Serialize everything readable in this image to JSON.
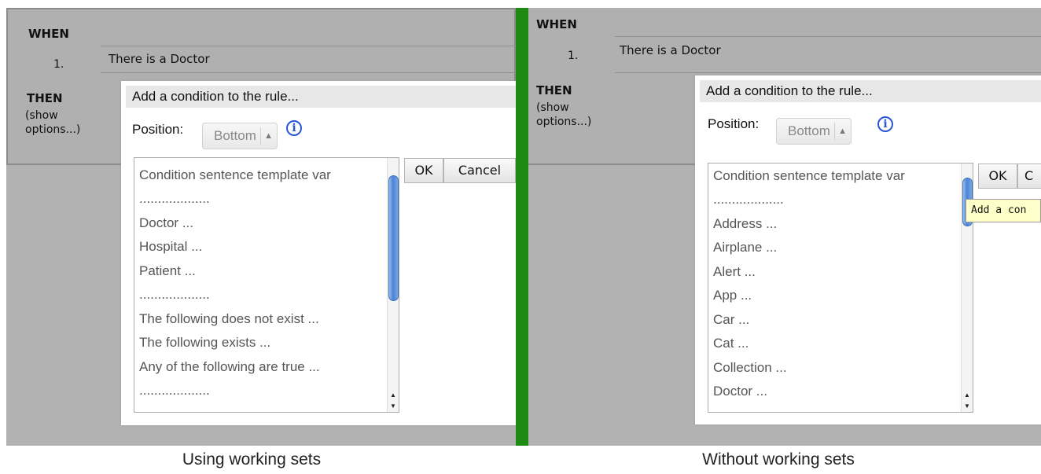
{
  "left": {
    "when_label": "WHEN",
    "then_label": "THEN",
    "show_options_line1": "(show",
    "show_options_line2": "options...)",
    "rule_number": "1.",
    "rule_text": "There is a Doctor",
    "popup": {
      "header": "Add a condition to the rule...",
      "position_label": "Position:",
      "position_value": "Bottom",
      "list_items": [
        "Condition sentence template var",
        "...................",
        "Doctor ...",
        "Hospital ...",
        "Patient ...",
        "...................",
        "The following does not exist ...",
        "The following exists ...",
        "Any of the following are true ...",
        "..................."
      ],
      "ok_label": "OK",
      "cancel_label": "Cancel"
    },
    "caption": "Using working sets"
  },
  "right": {
    "when_label": "WHEN",
    "then_label": "THEN",
    "show_options_line1": "(show",
    "show_options_line2": "options...)",
    "rule_number": "1.",
    "rule_text": "There is a Doctor",
    "popup": {
      "header": "Add a condition to the rule...",
      "position_label": "Position:",
      "position_value": "Bottom",
      "list_items": [
        "Condition sentence template var",
        "...................",
        "Address ...",
        "Airplane ...",
        "Alert ...",
        "App ...",
        "Car ...",
        "Cat ...",
        "Collection ...",
        "Doctor ..."
      ],
      "ok_label": "OK",
      "cancel_label": "C",
      "tooltip": "Add a con"
    },
    "caption": "Without working sets"
  },
  "colors": {
    "divider": "#1e8a14",
    "panel": "#b2b2b2",
    "scroll_thumb": "#4a82d6",
    "tooltip": "#ffffca"
  },
  "icons": {
    "info": "info-icon",
    "select_arrows": "up-down-arrows-icon"
  }
}
